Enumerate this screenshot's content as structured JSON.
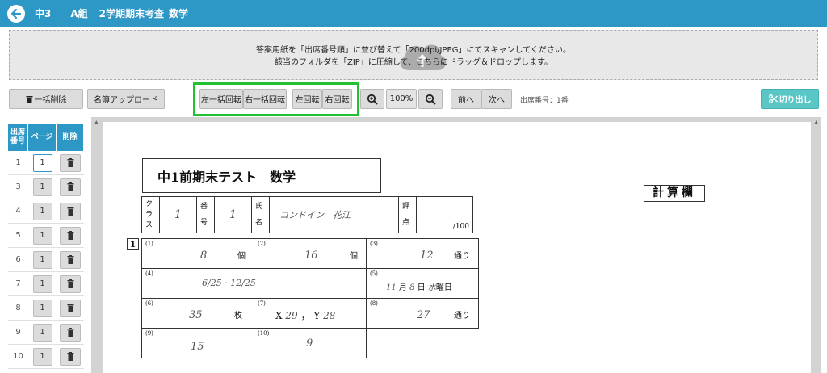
{
  "header": {
    "grade": "中3",
    "class_name": "A組",
    "exam_name": "2学期期末考査",
    "subject": "数学"
  },
  "upload": {
    "line1": "答案用紙を「出席番号順」に並び替えて「200dpi/JPEG」にてスキャンしてください。",
    "line2": "該当のフォルダを「ZIP」に圧縮して、こちらにドラッグ＆ドロップします。"
  },
  "toolbar": {
    "bulk_delete": "一括削除",
    "roster_upload": "名簿アップロード",
    "rotate_all_left": "左一括回転",
    "rotate_all_right": "右一括回転",
    "rotate_left": "左回転",
    "rotate_right": "右回転",
    "zoom": "100%",
    "prev": "前へ",
    "next": "次へ",
    "seat_number": "出席番号：1番",
    "cut_out": "切り出し"
  },
  "list": {
    "headers": [
      "出席\n番号",
      "ページ",
      "削除"
    ],
    "rows": [
      {
        "num": "1",
        "page": "1"
      },
      {
        "num": "3",
        "page": "1"
      },
      {
        "num": "4",
        "page": "1"
      },
      {
        "num": "5",
        "page": "1"
      },
      {
        "num": "6",
        "page": "1"
      },
      {
        "num": "7",
        "page": "1"
      },
      {
        "num": "8",
        "page": "1"
      },
      {
        "num": "9",
        "page": "1"
      },
      {
        "num": "10",
        "page": "1"
      }
    ]
  },
  "sheet": {
    "title": "中1前期末テスト　数学",
    "calc_label": "計算欄",
    "class_label": "クラス",
    "class_value": "1",
    "number_label": "番号",
    "number_value": "1",
    "name_label": "氏名",
    "name_value": "コンドイン　花江",
    "score_label": "評点",
    "score_suffix": "/100",
    "question_number": "1",
    "answers": [
      {
        "label": "(1)",
        "value": "8",
        "unit": "個"
      },
      {
        "label": "(2)",
        "value": "16",
        "unit": "個"
      },
      {
        "label": "(3)",
        "value": "12",
        "unit": "通り"
      },
      {
        "label": "(4)",
        "value": "6/25 · 12/25",
        "unit": ""
      },
      {
        "label": "(5)",
        "month": "11",
        "day": "8",
        "weekday": "水",
        "unit_month": "月",
        "unit_day": "日",
        "unit_weekday": "曜日"
      },
      {
        "label": "(6)",
        "value": "35",
        "unit": "枚"
      },
      {
        "label": "(7)",
        "x_label": "X",
        "x_value": "29",
        "y_label": "Y",
        "y_value": "28",
        "separator": "，"
      },
      {
        "label": "(8)",
        "value": "27",
        "unit": "通り"
      },
      {
        "label": "(9)",
        "value": "15",
        "unit": ""
      },
      {
        "label": "(10)",
        "value": "9",
        "unit": ""
      }
    ]
  }
}
